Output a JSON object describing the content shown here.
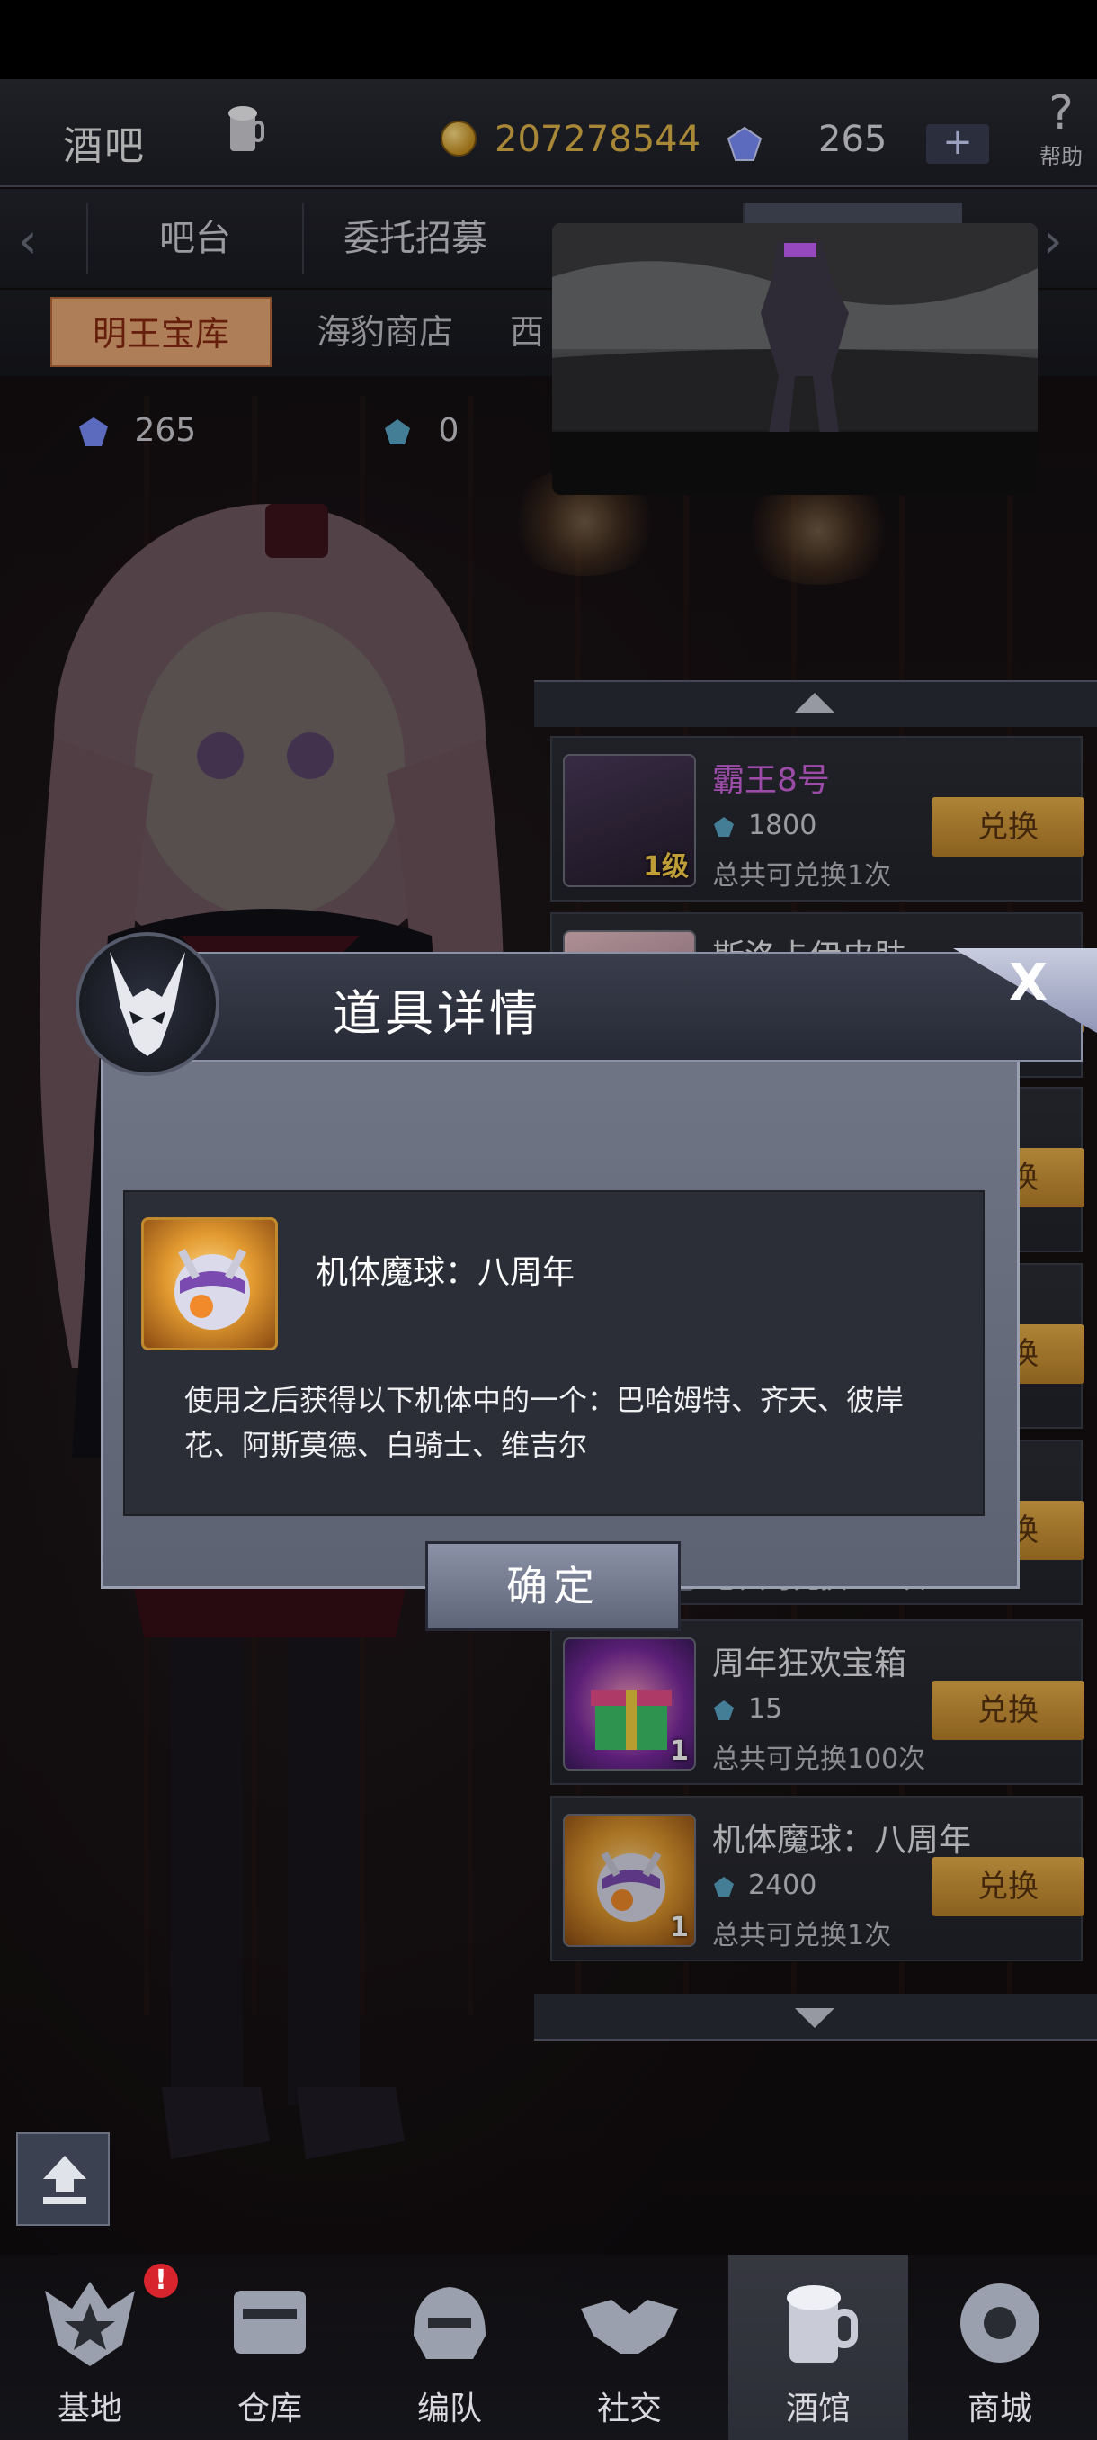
{
  "topbar": {
    "title": "酒吧",
    "coins": "207278544",
    "gems": "265",
    "plus_label": "+",
    "help_label": "帮助",
    "help_glyph": "?"
  },
  "tabs_primary": [
    {
      "label": "吧台"
    },
    {
      "label": "委托招募"
    },
    {
      "label": ""
    }
  ],
  "tabs_secondary": [
    {
      "label": "明王宝库",
      "active": true
    },
    {
      "label": "海豹商店"
    },
    {
      "label": "西"
    }
  ],
  "currency": {
    "gems": "265",
    "tokens": "0"
  },
  "shop_items": [
    {
      "name": "霸王8号",
      "cost": "1800",
      "limit": "总共可兑换1次",
      "count": "1级",
      "button": "兑换"
    },
    {
      "name": "斯洛卡伊皮肤",
      "cost": "",
      "limit": "",
      "count": "",
      "button": "兑换"
    },
    {
      "name": "",
      "cost": "",
      "limit": "",
      "count": "",
      "button": "兑换"
    },
    {
      "name": "",
      "cost": "",
      "limit": "",
      "count": "",
      "button": "兑换"
    },
    {
      "name": "",
      "cost": "",
      "limit": "总共可兑换100次",
      "count": "1",
      "button": "兑换"
    },
    {
      "name": "周年狂欢宝箱",
      "cost": "15",
      "limit": "总共可兑换100次",
      "count": "1",
      "button": "兑换"
    },
    {
      "name": "机体魔球：八周年",
      "cost": "2400",
      "limit": "总共可兑换1次",
      "count": "1",
      "button": "兑换"
    }
  ],
  "modal": {
    "title": "道具详情",
    "close_label": "X",
    "item_name": "机体魔球：八周年",
    "description": "使用之后获得以下机体中的一个：巴哈姆特、齐天、彼岸花、阿斯莫德、白骑士、维吉尔",
    "confirm_label": "确定"
  },
  "bottom_nav": [
    {
      "label": "基地",
      "badge": "!"
    },
    {
      "label": "仓库"
    },
    {
      "label": "编队"
    },
    {
      "label": "社交"
    },
    {
      "label": "酒馆",
      "active": true
    },
    {
      "label": "商城"
    }
  ],
  "colors": {
    "coin": "#e0b44a",
    "exchange_button": "#d9a040",
    "active_tab": "#e7a875",
    "badge": "#d8242c",
    "purple_name": "#d066e0"
  }
}
